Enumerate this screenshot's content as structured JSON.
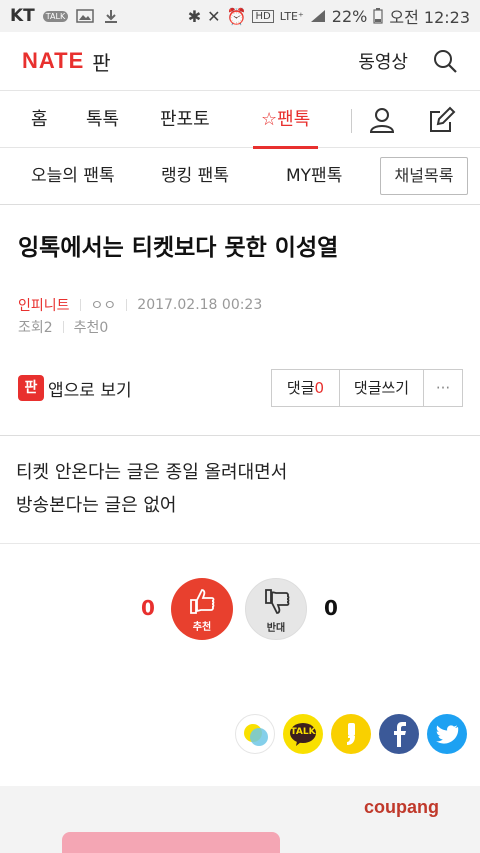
{
  "status_bar": {
    "carrier": "KT",
    "talk_badge": "TALK",
    "battery": "22%",
    "time": "오전 12:23",
    "lte": "LTE⁺"
  },
  "header": {
    "logo": "NATE",
    "logo_sub": "판",
    "video_label": "동영상"
  },
  "nav": {
    "items": [
      "홈",
      "톡톡",
      "판포토",
      "☆팬톡"
    ]
  },
  "subnav": {
    "items": [
      "오늘의 팬톡",
      "랭킹 팬톡",
      "MY팬톡"
    ],
    "channel_list": "채널목록"
  },
  "article": {
    "title": "잉톡에서는 티켓보다 못한 이성열",
    "channel": "인피니트",
    "author": "ㅇㅇ",
    "datetime": "2017.02.18 00:23",
    "views": "조회2",
    "recommends": "추천0",
    "app_view": "앱으로 보기",
    "app_icon_text": "판",
    "comment_label": "댓글",
    "comment_count": "0",
    "write_comment": "댓글쓰기",
    "more": "···",
    "body_lines": [
      "티켓 안온다는 글은 종일 올려대면서",
      "방송본다는 글은 없어"
    ]
  },
  "vote": {
    "up_count": "0",
    "up_label": "추천",
    "down_label": "반대",
    "down_count": "0"
  },
  "share": {
    "kakaotalk_label": "TALK"
  },
  "ad": {
    "brand": "coupang"
  },
  "colors": {
    "accent": "#e8302e",
    "kakao_yellow": "#f9e000",
    "facebook": "#3b5998",
    "twitter": "#1da1f2"
  }
}
